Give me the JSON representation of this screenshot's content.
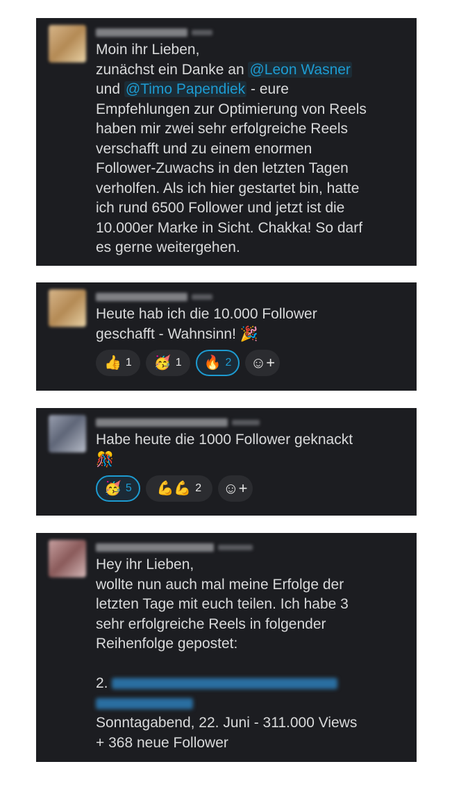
{
  "messages": [
    {
      "lines": [
        "Moin ihr Lieben,",
        "zunächst ein Danke an",
        "@Leon Wasner",
        "und",
        "@Timo Papendiek",
        " - eure",
        "Empfehlungen zur Optimierung von Reels",
        "haben mir zwei sehr erfolgreiche Reels",
        "verschafft und zu einem enormen",
        "Follower-Zuwachs in den letzten Tagen",
        "verholfen. Als ich hier gestartet bin, hatte",
        "ich rund 6500 Follower und jetzt ist die",
        "10.000er Marke in Sicht. Chakka! So darf",
        "es gerne weitergehen."
      ]
    },
    {
      "lines": [
        "Heute hab ich die 10.000 Follower",
        "geschafft - Wahnsinn! 🎉"
      ],
      "reactions": [
        {
          "emoji": "👍",
          "count": "1"
        },
        {
          "emoji": "🥳",
          "count": "1"
        },
        {
          "emoji": "🔥",
          "count": "2"
        },
        {
          "emoji": "☺+",
          "count": ""
        }
      ]
    },
    {
      "lines": [
        "Habe heute die 1000 Follower geknackt",
        "🎊"
      ],
      "reactions": [
        {
          "emoji": "🥳",
          "count": "5"
        },
        {
          "emoji": "💪💪",
          "count": "2"
        },
        {
          "emoji": "☺+",
          "count": ""
        }
      ]
    },
    {
      "lines": [
        "Hey ihr Lieben,",
        "wollte nun auch mal meine Erfolge der",
        "letzten Tage mit euch teilen. Ich habe 3",
        "sehr erfolgreiche Reels in folgender",
        "Reihenfolge gepostet:",
        "2.",
        "Sonntagabend, 22. Juni - 311.000 Views",
        "+ 368 neue Follower"
      ]
    }
  ],
  "colors": {
    "card_bg": "#1c1d21",
    "text": "#d9dadb",
    "mention": "#1d9bd1",
    "reaction_bg": "#2b2c30",
    "reaction_active_border": "#1d9bd1"
  }
}
